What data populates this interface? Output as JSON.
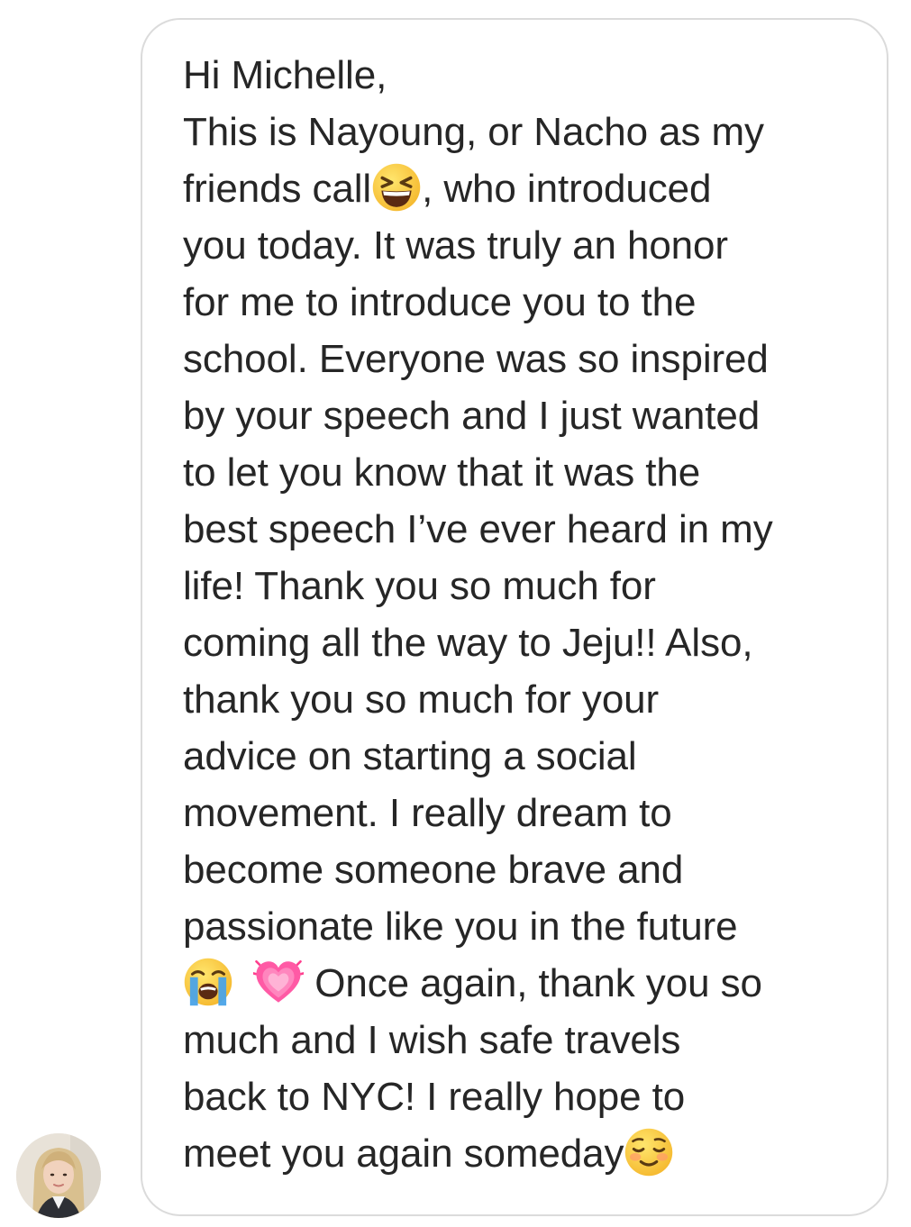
{
  "message": {
    "greeting": "Hi Michelle,",
    "lines": [
      {
        "before": "This is Nayoung, or Nacho as my"
      },
      {
        "before": "friends call",
        "emoji": "grinning-squinting-face-emoji",
        "after": ", who introduced"
      },
      {
        "before": "you today. It was truly an honor"
      },
      {
        "before": "for me to introduce you to the"
      },
      {
        "before": "school. Everyone was so inspired"
      },
      {
        "before": "by your speech and I just wanted"
      },
      {
        "before": "to let you know that it was the"
      },
      {
        "before": "best speech I’ve ever heard in my"
      },
      {
        "before": "life! Thank you so much for"
      },
      {
        "before": "coming all the way to Jeju!! Also,"
      },
      {
        "before": "thank you so much for your"
      },
      {
        "before": "advice on starting a social"
      },
      {
        "before": "movement. I really dream to"
      },
      {
        "before": "become someone brave and"
      },
      {
        "before": "passionate like you in the future"
      },
      {
        "emojis": [
          "loudly-crying-face-emoji",
          "growing-heart-emoji"
        ],
        "after": " Once again, thank you so"
      },
      {
        "before": "much and I wish safe travels"
      },
      {
        "before": "back to NYC! I really hope to"
      },
      {
        "before": "meet you again someday",
        "emoji": "smiling-face-emoji"
      }
    ]
  },
  "sender": {
    "avatar_icon": "profile-photo-avatar"
  },
  "colors": {
    "text": "#262626",
    "bubble_border": "#dbdbdb",
    "background": "#ffffff"
  }
}
